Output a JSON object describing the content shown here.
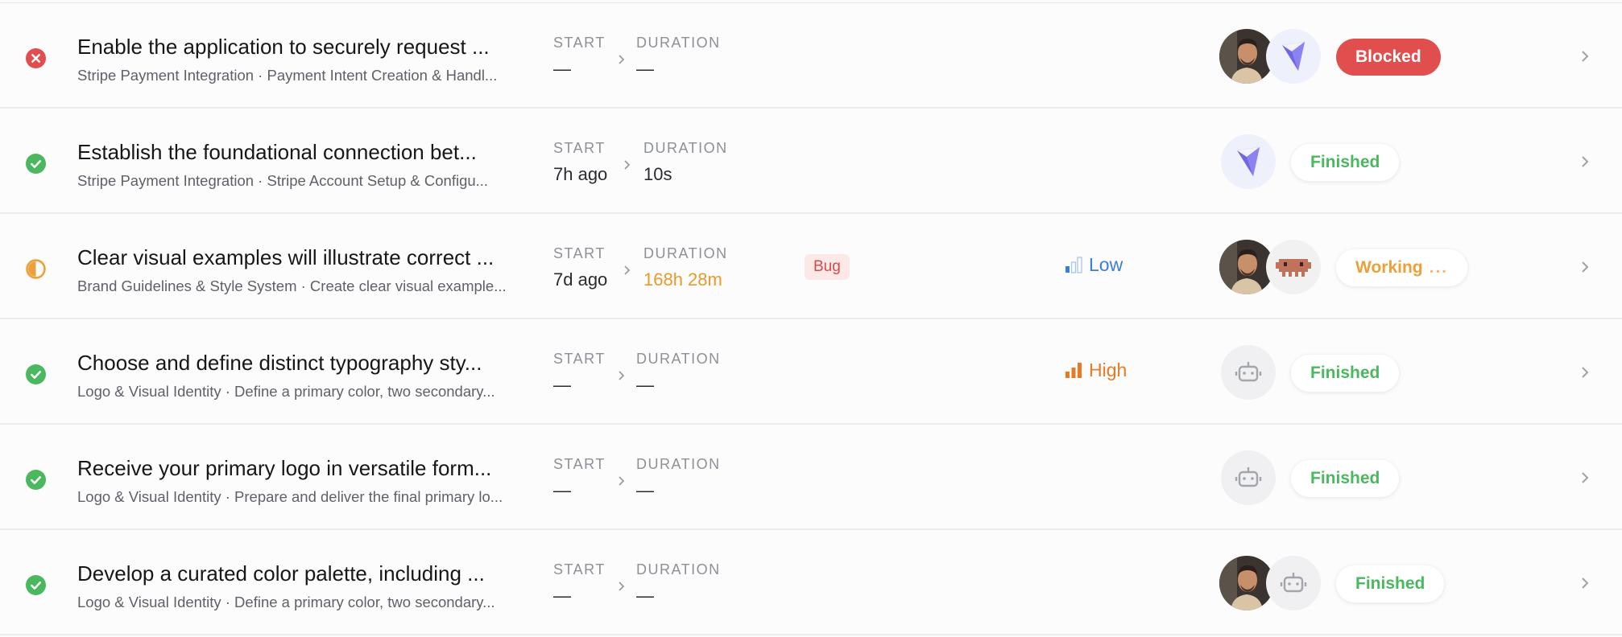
{
  "colors": {
    "error_red": "#e04e4e",
    "success_green": "#4bb85f",
    "working_orange": "#eba03a",
    "low_blue": "#3b7ddd",
    "high_orange": "#e87a25",
    "bug_red": "#d44a4a"
  },
  "labels": {
    "start": "START",
    "duration": "DURATION"
  },
  "rows": [
    {
      "status_icon": "error-x-icon",
      "title": "Enable the application to securely request ...",
      "subtitle": "Stripe Payment Integration · Payment Intent Creation & Handl...",
      "start": "—",
      "duration": "—",
      "badge": "Blocked",
      "assignees": [
        "user-avatar",
        "cube-agent-icon"
      ]
    },
    {
      "status_icon": "check-circle-icon",
      "title": "Establish the foundational connection bet...",
      "subtitle": "Stripe Payment Integration · Stripe Account Setup & Configu...",
      "start": "7h ago",
      "duration": "10s",
      "badge": "Finished",
      "assignees": [
        "cube-agent-icon"
      ]
    },
    {
      "status_icon": "half-circle-icon",
      "title": "Clear visual examples will illustrate correct ...",
      "subtitle": "Brand Guidelines & Style System · Create clear visual example...",
      "start": "7d ago",
      "duration": "168h 28m",
      "tag": "Bug",
      "priority": "Low",
      "badge": "Working",
      "badge_dots": "...",
      "assignees": [
        "user-avatar",
        "pixel-robot-icon"
      ]
    },
    {
      "status_icon": "check-circle-icon",
      "title": "Choose and define distinct typography sty...",
      "subtitle": "Logo & Visual Identity · Define a primary color, two secondary...",
      "start": "—",
      "duration": "—",
      "priority": "High",
      "badge": "Finished",
      "assignees": [
        "robot-icon"
      ]
    },
    {
      "status_icon": "check-circle-icon",
      "title": "Receive your primary logo in versatile form...",
      "subtitle": "Logo & Visual Identity · Prepare and deliver the final primary lo...",
      "start": "—",
      "duration": "—",
      "badge": "Finished",
      "assignees": [
        "robot-icon"
      ]
    },
    {
      "status_icon": "check-circle-icon",
      "title": "Develop a curated color palette, including ...",
      "subtitle": "Logo & Visual Identity · Define a primary color, two secondary...",
      "start": "—",
      "duration": "—",
      "badge": "Finished",
      "assignees": [
        "user-avatar",
        "robot-icon"
      ]
    }
  ]
}
